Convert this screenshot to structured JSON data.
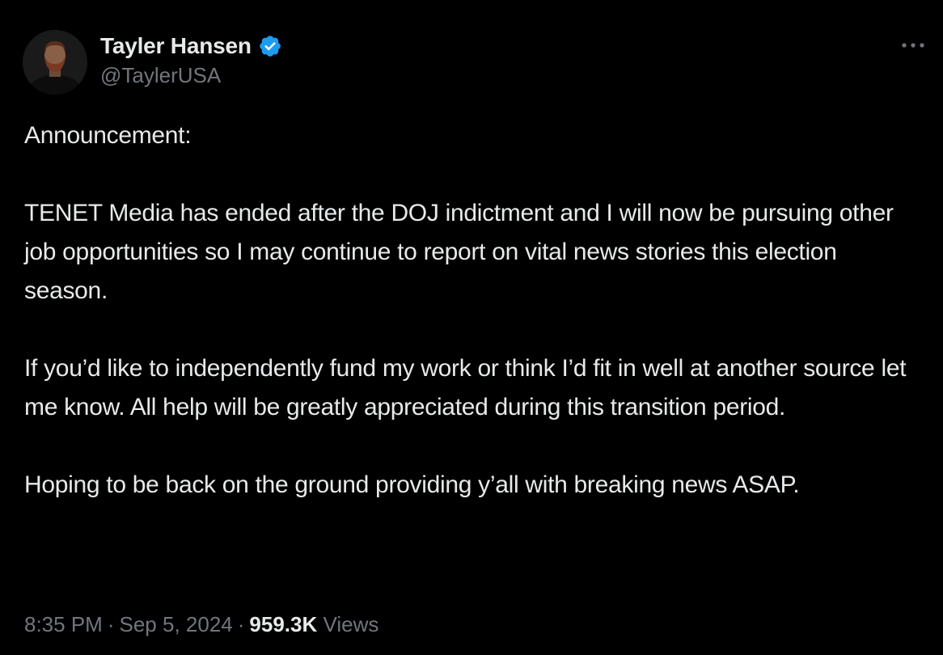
{
  "author": {
    "display_name": "Tayler Hansen",
    "handle": "@TaylerUSA",
    "verified": true,
    "avatar_icon": "user-avatar"
  },
  "tweet": {
    "paragraphs": [
      "Announcement:",
      "TENET Media has ended after the DOJ indictment and I will now be pursuing other job opportunities so I may continue to report on vital news stories this election season.",
      "If you’d like to independently fund my work or think I’d fit in well at another source let me know. All help will be greatly appreciated during this transition period.",
      "Hoping to be back on the ground providing y’all with breaking news ASAP."
    ]
  },
  "meta": {
    "time": "8:35 PM",
    "date": "Sep 5, 2024",
    "separator": "·",
    "views_count": "959.3K",
    "views_label": "Views"
  },
  "icons": {
    "verified": "verified-badge-icon",
    "more": "more-options-icon"
  },
  "colors": {
    "background": "#000000",
    "text_primary": "#e7e9ea",
    "text_secondary": "#71767b",
    "verified_blue": "#1d9bf0"
  }
}
